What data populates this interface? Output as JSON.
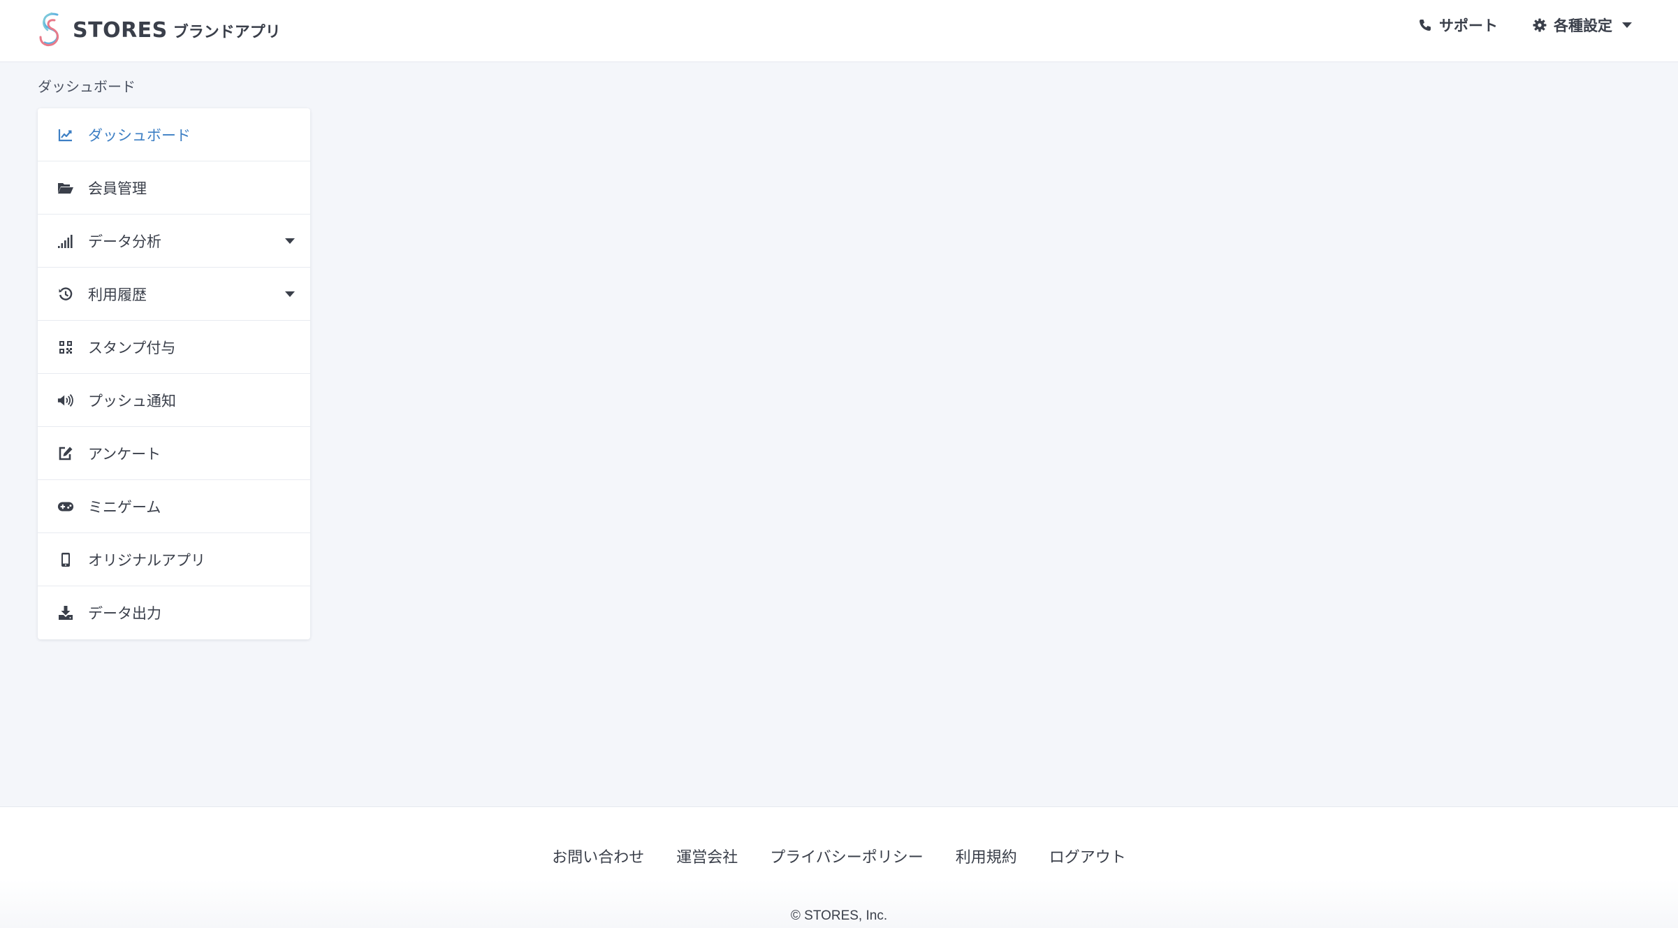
{
  "header": {
    "brand_word": "STORES",
    "brand_sub": "ブランドアプリ",
    "support_label": "サポート",
    "settings_label": "各種設定"
  },
  "breadcrumb": "ダッシュボード",
  "sidebar": {
    "items": [
      {
        "label": "ダッシュボード",
        "icon": "chart-line-icon",
        "active": true
      },
      {
        "label": "会員管理",
        "icon": "folder-open-icon"
      },
      {
        "label": "データ分析",
        "icon": "signal-bars-icon",
        "has_submenu": true
      },
      {
        "label": "利用履歴",
        "icon": "history-icon",
        "has_submenu": true
      },
      {
        "label": "スタンプ付与",
        "icon": "qrcode-icon"
      },
      {
        "label": "プッシュ通知",
        "icon": "volume-icon"
      },
      {
        "label": "アンケート",
        "icon": "edit-icon"
      },
      {
        "label": "ミニゲーム",
        "icon": "gamepad-icon"
      },
      {
        "label": "オリジナルアプリ",
        "icon": "mobile-icon"
      },
      {
        "label": "データ出力",
        "icon": "download-icon"
      }
    ]
  },
  "footer": {
    "links": [
      "お問い合わせ",
      "運営会社",
      "プライバシーポリシー",
      "利用規約",
      "ログアウト"
    ],
    "copyright": "© STORES, Inc."
  },
  "colors": {
    "accent": "#3d7fc4",
    "text": "#3a3f4a",
    "background": "#f4f6fa"
  }
}
